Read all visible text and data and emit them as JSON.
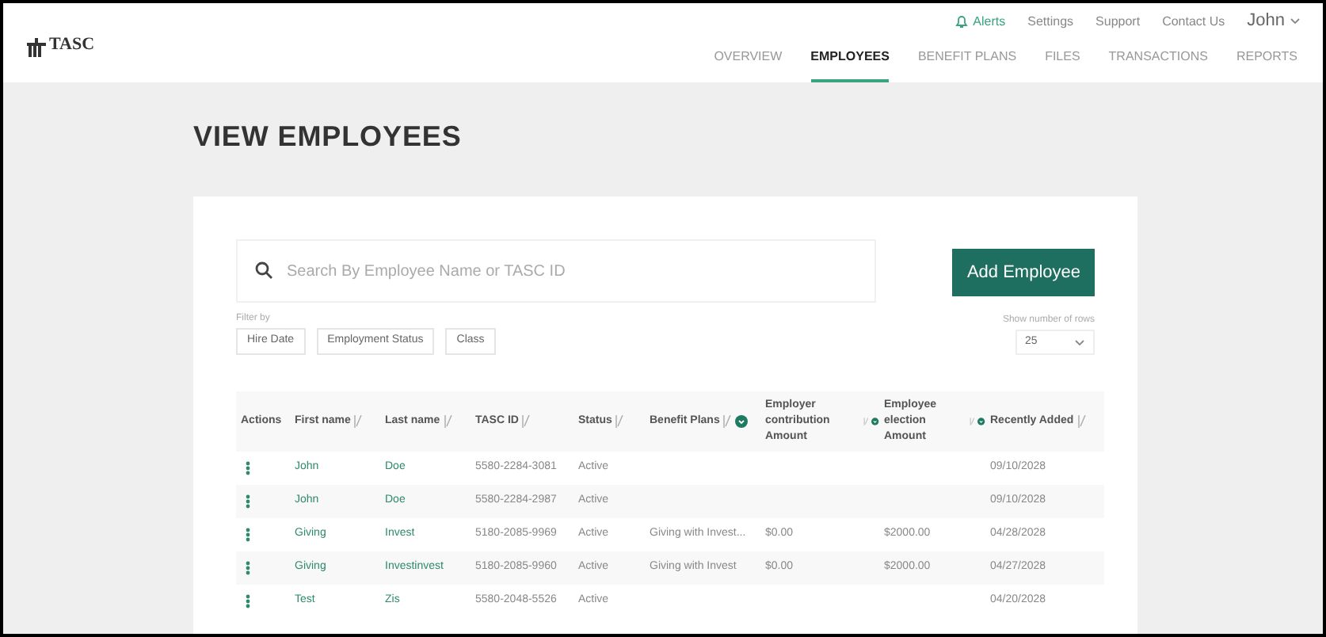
{
  "logo": {
    "text": "TASC"
  },
  "utility_links": [
    {
      "label": "Alerts",
      "kind": "alert"
    },
    {
      "label": "Settings",
      "kind": "link"
    },
    {
      "label": "Support",
      "kind": "link"
    },
    {
      "label": "Contact Us",
      "kind": "link"
    },
    {
      "label": "John",
      "kind": "user"
    }
  ],
  "tabs": [
    {
      "label": "OVERVIEW",
      "selected": false
    },
    {
      "label": "EMPLOYEES",
      "selected": true
    },
    {
      "label": "BENEFIT PLANS",
      "selected": false
    },
    {
      "label": "FILES",
      "selected": false
    },
    {
      "label": "TRANSACTIONS",
      "selected": false
    },
    {
      "label": "REPORTS",
      "selected": false
    }
  ],
  "page_title": "VIEW EMPLOYEES",
  "search": {
    "placeholder": "Search By Employee Name or TASC ID"
  },
  "add_button": "Add Employee",
  "filter": {
    "label": "Filter by",
    "chips": [
      "Hire Date",
      "Employment Status",
      "Class"
    ]
  },
  "rows_select": {
    "label": "Show number of rows",
    "value": "25"
  },
  "table": {
    "columns": [
      {
        "label": "Actions",
        "sortable": false,
        "info": false
      },
      {
        "label": "First name",
        "sortable": true,
        "info": false
      },
      {
        "label": "Last name",
        "sortable": true,
        "info": false
      },
      {
        "label": "TASC ID",
        "sortable": true,
        "info": false
      },
      {
        "label": "Status",
        "sortable": true,
        "info": false
      },
      {
        "label": "Benefit Plans",
        "sortable": true,
        "info": true
      },
      {
        "label": "Employer contribution Amount",
        "sortable": true,
        "info": true
      },
      {
        "label": "Employee election Amount",
        "sortable": true,
        "info": true
      },
      {
        "label": "Recently Added",
        "sortable": true,
        "info": false
      }
    ],
    "rows": [
      {
        "cells": [
          "",
          "John",
          "Doe",
          "5580-2284-3081",
          "Active",
          "",
          "",
          "",
          "09/10/2028"
        ]
      },
      {
        "cells": [
          "",
          "John",
          "Doe",
          "5580-2284-2987",
          "Active",
          "",
          "",
          "",
          "09/10/2028"
        ]
      },
      {
        "cells": [
          "",
          "Giving",
          "Invest",
          "5180-2085-9969",
          "Active",
          "Giving with Invest...",
          "$0.00",
          "$2000.00",
          "04/28/2028"
        ]
      },
      {
        "cells": [
          "",
          "Giving",
          "Investinvest",
          "5180-2085-9960",
          "Active",
          "Giving with Invest",
          "$0.00",
          "$2000.00",
          "04/27/2028"
        ]
      },
      {
        "cells": [
          "",
          "Test",
          "Zis",
          "5580-2048-5526",
          "Active",
          "",
          "",
          "",
          "04/20/2028"
        ]
      }
    ]
  }
}
